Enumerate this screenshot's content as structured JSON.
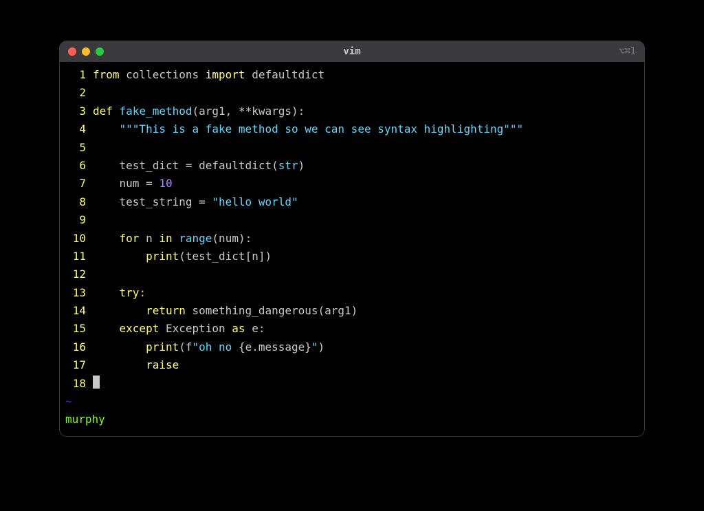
{
  "window": {
    "title": "vim",
    "shortcut": "⌥⌘1"
  },
  "status_line": "murphy",
  "tilde": "~",
  "lines": [
    {
      "n": "1",
      "tokens": [
        {
          "c": "kw",
          "t": "from"
        },
        {
          "c": "ident",
          "t": " collections "
        },
        {
          "c": "kw",
          "t": "import"
        },
        {
          "c": "ident",
          "t": " defaultdict"
        }
      ]
    },
    {
      "n": "2",
      "tokens": []
    },
    {
      "n": "3",
      "tokens": [
        {
          "c": "kw",
          "t": "def"
        },
        {
          "c": "ident",
          "t": " "
        },
        {
          "c": "fn",
          "t": "fake_method"
        },
        {
          "c": "sym",
          "t": "(arg1, **kwargs):"
        }
      ]
    },
    {
      "n": "4",
      "tokens": [
        {
          "c": "ident",
          "t": "    "
        },
        {
          "c": "str",
          "t": "\"\"\"This is a fake method so we can see syntax highlighting\"\"\""
        }
      ]
    },
    {
      "n": "5",
      "tokens": []
    },
    {
      "n": "6",
      "tokens": [
        {
          "c": "ident",
          "t": "    test_dict "
        },
        {
          "c": "sym",
          "t": "= "
        },
        {
          "c": "ident",
          "t": "defaultdict("
        },
        {
          "c": "builtin",
          "t": "str"
        },
        {
          "c": "sym",
          "t": ")"
        }
      ]
    },
    {
      "n": "7",
      "tokens": [
        {
          "c": "ident",
          "t": "    num "
        },
        {
          "c": "sym",
          "t": "= "
        },
        {
          "c": "num",
          "t": "10"
        }
      ]
    },
    {
      "n": "8",
      "tokens": [
        {
          "c": "ident",
          "t": "    test_string "
        },
        {
          "c": "sym",
          "t": "= "
        },
        {
          "c": "str",
          "t": "\"hello world\""
        }
      ]
    },
    {
      "n": "9",
      "tokens": []
    },
    {
      "n": "10",
      "tokens": [
        {
          "c": "ident",
          "t": "    "
        },
        {
          "c": "kw",
          "t": "for"
        },
        {
          "c": "ident",
          "t": " n "
        },
        {
          "c": "kw",
          "t": "in"
        },
        {
          "c": "ident",
          "t": " "
        },
        {
          "c": "builtin",
          "t": "range"
        },
        {
          "c": "sym",
          "t": "(num):"
        }
      ]
    },
    {
      "n": "11",
      "tokens": [
        {
          "c": "ident",
          "t": "        "
        },
        {
          "c": "kw",
          "t": "print"
        },
        {
          "c": "sym",
          "t": "(test_dict[n])"
        }
      ]
    },
    {
      "n": "12",
      "tokens": []
    },
    {
      "n": "13",
      "tokens": [
        {
          "c": "ident",
          "t": "    "
        },
        {
          "c": "kw",
          "t": "try"
        },
        {
          "c": "sym",
          "t": ":"
        }
      ]
    },
    {
      "n": "14",
      "tokens": [
        {
          "c": "ident",
          "t": "        "
        },
        {
          "c": "kw",
          "t": "return"
        },
        {
          "c": "ident",
          "t": " something_dangerous(arg1)"
        }
      ]
    },
    {
      "n": "15",
      "tokens": [
        {
          "c": "ident",
          "t": "    "
        },
        {
          "c": "kw",
          "t": "except"
        },
        {
          "c": "ident",
          "t": " Exception "
        },
        {
          "c": "kw",
          "t": "as"
        },
        {
          "c": "ident",
          "t": " e:"
        }
      ]
    },
    {
      "n": "16",
      "tokens": [
        {
          "c": "ident",
          "t": "        "
        },
        {
          "c": "kw",
          "t": "print"
        },
        {
          "c": "sym",
          "t": "(f"
        },
        {
          "c": "str",
          "t": "\"oh no "
        },
        {
          "c": "sym",
          "t": "{e.message}"
        },
        {
          "c": "str",
          "t": "\""
        },
        {
          "c": "sym",
          "t": ")"
        }
      ]
    },
    {
      "n": "17",
      "tokens": [
        {
          "c": "ident",
          "t": "        "
        },
        {
          "c": "kw",
          "t": "raise"
        }
      ]
    },
    {
      "n": "18",
      "tokens": [
        {
          "c": "cursor",
          "t": ""
        }
      ]
    }
  ]
}
